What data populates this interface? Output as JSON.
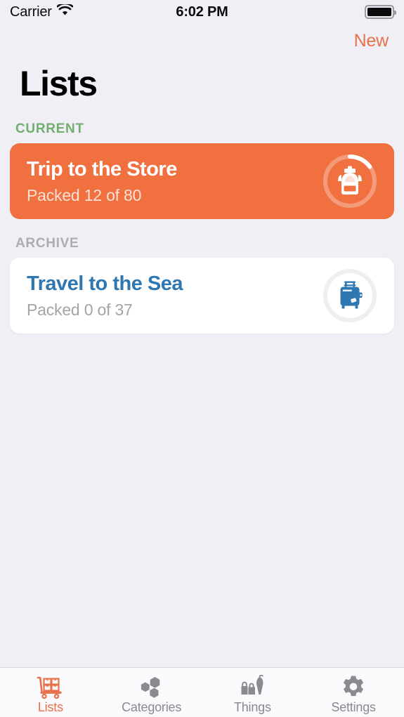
{
  "status_bar": {
    "carrier": "Carrier",
    "wifi_icon": "wifi-icon",
    "time": "6:02 PM",
    "battery_icon": "battery-full-icon"
  },
  "nav": {
    "new_label": "New"
  },
  "page_title": "Lists",
  "sections": [
    {
      "header": "CURRENT",
      "header_color": "#71AF6F",
      "card": {
        "title": "Trip to the Store",
        "subtitle": "Packed 12 of 80",
        "packed": 12,
        "total": 80,
        "progress_percent": 15,
        "icon": "backpack-icon",
        "background_color": "#F0703F",
        "title_color": "#FFFFFF"
      }
    },
    {
      "header": "ARCHIVE",
      "header_color": "#ACACB4",
      "card": {
        "title": "Travel to the Sea",
        "subtitle": "Packed 0 of 37",
        "packed": 0,
        "total": 37,
        "progress_percent": 0,
        "icon": "suitcase-icon",
        "background_color": "#FFFFFF",
        "title_color": "#2E77B0"
      }
    }
  ],
  "tab_bar": {
    "active_color": "#E8714A",
    "inactive_color": "#8A8A90",
    "tabs": [
      {
        "label": "Lists",
        "icon": "cart-with-boxes-icon",
        "active": true
      },
      {
        "label": "Categories",
        "icon": "hexagons-icon",
        "active": false
      },
      {
        "label": "Things",
        "icon": "bags-umbrella-icon",
        "active": false
      },
      {
        "label": "Settings",
        "icon": "gear-icon",
        "active": false
      }
    ]
  }
}
